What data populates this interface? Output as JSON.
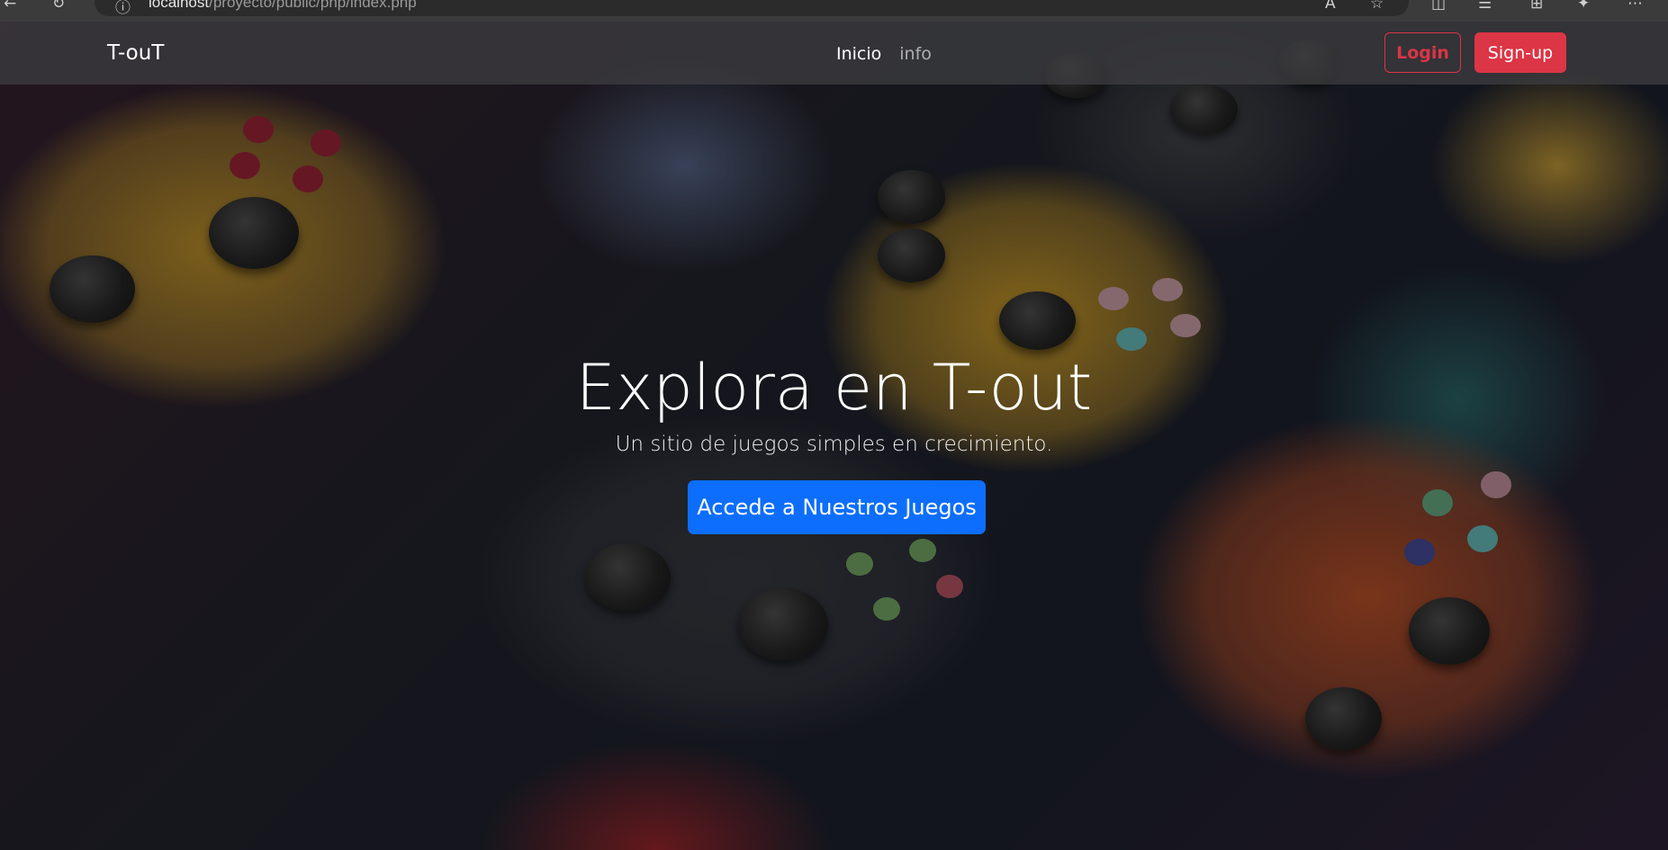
{
  "browser": {
    "url_host": "localhost",
    "url_path": "/proyecto/public/php/index.php"
  },
  "navbar": {
    "brand": "T-ouT",
    "links": [
      {
        "label": "Inicio",
        "active": true
      },
      {
        "label": "info",
        "active": false
      }
    ],
    "login_label": "Login",
    "signup_label": "Sign-up"
  },
  "hero": {
    "title": "Explora en T-out",
    "subtitle": "Un sitio de juegos simples en crecimiento.",
    "cta_label": "Accede a Nuestros Juegos"
  },
  "colors": {
    "primary": "#0d6efd",
    "danger": "#dc3545",
    "navbar_bg": "#3c3c40"
  },
  "icons": [
    "back-icon",
    "refresh-icon",
    "info-icon",
    "read-aloud-icon",
    "favorite-star-icon",
    "split-screen-icon",
    "favorites-icon",
    "collections-icon",
    "extensions-icon",
    "more-icon"
  ]
}
